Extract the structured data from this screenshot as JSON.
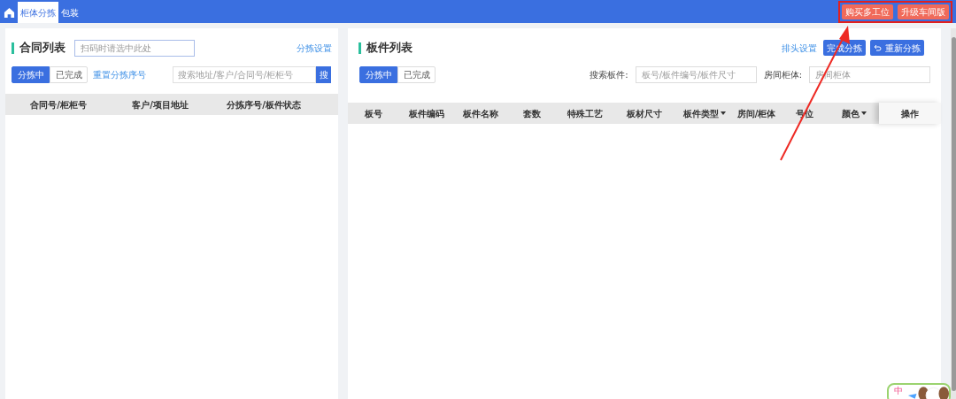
{
  "top_bar": {
    "tabs": [
      {
        "label": "柜体分拣",
        "selected": true
      },
      {
        "label": "包装",
        "selected": false
      }
    ],
    "buttons": [
      "购买多工位",
      "升级车间版"
    ]
  },
  "contract_panel": {
    "title": "合同列表",
    "scan_field": {
      "placeholder": "扫码时请选中此处"
    },
    "settings_link": "分拣设置",
    "filters": [
      {
        "label": "分拣中",
        "selected": true
      },
      {
        "label": "已完成",
        "selected": false
      }
    ],
    "reset_link": "重置分拣序号",
    "search": {
      "placeholder": "搜索地址/客户/合同号/柜柜号",
      "button": "搜"
    },
    "columns": [
      "合同号/柜柜号",
      "客户/项目地址",
      "分拣序号/板件状态"
    ]
  },
  "board_panel": {
    "title": "板件列表",
    "header_link": "排头设置",
    "buttons": [
      {
        "label": "完成分拣",
        "kind": "plain"
      },
      {
        "label": "重新分拣",
        "kind": "undo"
      }
    ],
    "filters": [
      {
        "label": "分拣中",
        "selected": true
      },
      {
        "label": "已完成",
        "selected": false
      }
    ],
    "search_fields": [
      {
        "label": "搜索板件:",
        "placeholder": "板号/板件编号/板件尺寸"
      },
      {
        "label": "房间柜体:",
        "placeholder": "房间柜体"
      }
    ],
    "columns": [
      {
        "label": "板号",
        "dropdown": false,
        "fixed": false
      },
      {
        "label": "板件编码",
        "dropdown": false,
        "fixed": false
      },
      {
        "label": "板件名称",
        "dropdown": false,
        "fixed": false
      },
      {
        "label": "套数",
        "dropdown": false,
        "fixed": false
      },
      {
        "label": "特殊工艺",
        "dropdown": false,
        "fixed": false
      },
      {
        "label": "板材尺寸",
        "dropdown": false,
        "fixed": false
      },
      {
        "label": "板件类型",
        "dropdown": true,
        "fixed": false
      },
      {
        "label": "房间/柜体",
        "dropdown": false,
        "fixed": false
      },
      {
        "label": "号位",
        "dropdown": false,
        "fixed": false
      },
      {
        "label": "颜色",
        "dropdown": true,
        "fixed": false
      },
      {
        "label": "操作",
        "dropdown": false,
        "fixed": true
      }
    ]
  },
  "ime_widget": {
    "label": "中"
  }
}
